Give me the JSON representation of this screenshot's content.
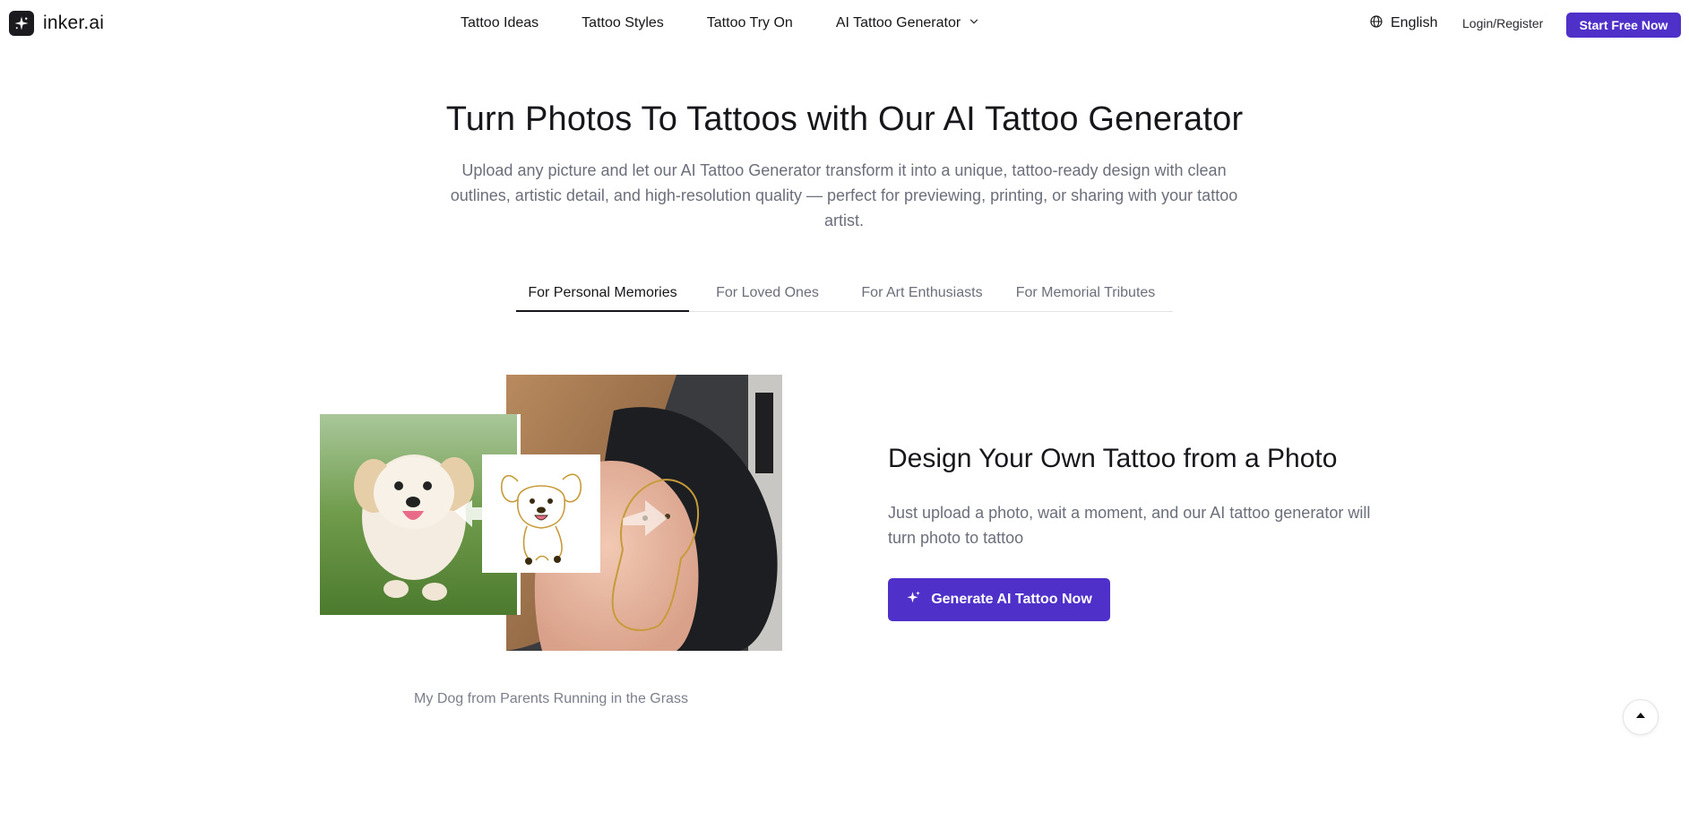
{
  "header": {
    "brand": "inker.ai",
    "nav": [
      {
        "label": "Tattoo Ideas"
      },
      {
        "label": "Tattoo Styles"
      },
      {
        "label": "Tattoo Try On"
      },
      {
        "label": "AI Tattoo Generator"
      }
    ],
    "language": "English",
    "login": "Login/Register",
    "cta": "Start Free Now"
  },
  "hero": {
    "title": "Turn Photos To Tattoos with Our AI Tattoo Generator",
    "subtitle": "Upload any picture and let our AI Tattoo Generator transform it into a unique, tattoo-ready design with clean outlines, artistic detail, and high-resolution quality — perfect for previewing, printing, or sharing with your tattoo artist."
  },
  "tabs": [
    {
      "label": "For Personal Memories",
      "active": true
    },
    {
      "label": "For Loved Ones",
      "active": false
    },
    {
      "label": "For Art Enthusiasts",
      "active": false
    },
    {
      "label": "For Memorial Tributes",
      "active": false
    }
  ],
  "showcase": {
    "caption": "My Dog from Parents Running in the Grass"
  },
  "feature": {
    "title": "Design Your Own Tattoo from a Photo",
    "description": "Just upload a photo, wait a moment, and our AI tattoo generator will turn photo to tattoo",
    "button": "Generate AI Tattoo Now"
  },
  "colors": {
    "accent": "#4f31c9",
    "text": "#17171b",
    "muted": "#6b6f7b"
  },
  "icons": [
    "sparkle-logo-icon",
    "chevron-down-icon",
    "globe-icon",
    "sparkle-icon",
    "arrow-up-icon"
  ]
}
